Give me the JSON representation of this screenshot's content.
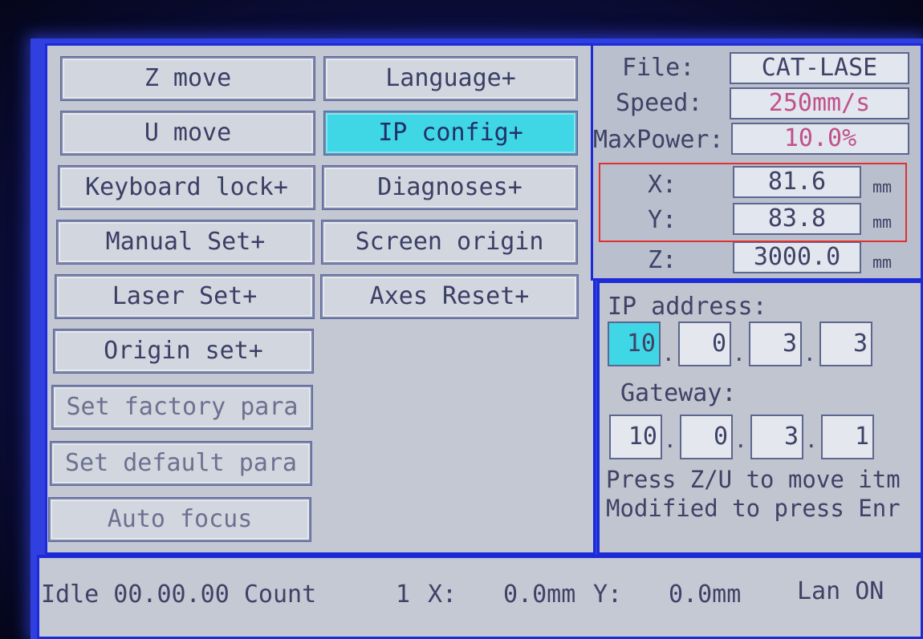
{
  "menu": {
    "left": [
      {
        "label": "Z move"
      },
      {
        "label": "U move"
      },
      {
        "label": "Keyboard lock+"
      },
      {
        "label": "Manual Set+"
      },
      {
        "label": "Laser Set+"
      },
      {
        "label": "Origin set+"
      },
      {
        "label": "Set factory para"
      },
      {
        "label": "Set default para"
      },
      {
        "label": "Auto focus"
      }
    ],
    "right": [
      {
        "label": "Language+"
      },
      {
        "label": "IP config+"
      },
      {
        "label": "Diagnoses+"
      },
      {
        "label": "Screen origin"
      },
      {
        "label": "Axes Reset+"
      }
    ]
  },
  "info": {
    "file_label": "File:",
    "file_value": "CAT-LASE",
    "speed_label": "Speed:",
    "speed_value": "250mm/s",
    "power_label": "MaxPower:",
    "power_value": "10.0%",
    "x_label": "X:",
    "x_value": "81.6",
    "y_label": "Y:",
    "y_value": "83.8",
    "z_label": "Z:",
    "z_value": "3000.0",
    "unit": "mm"
  },
  "ip": {
    "address_label": "IP address:",
    "address": [
      "10",
      "0",
      "3",
      "3"
    ],
    "gateway_label": "Gateway:",
    "gateway": [
      "10",
      "0",
      "3",
      "1"
    ],
    "hint1": "Press Z/U to move itm",
    "hint2": "Modified to press Enr"
  },
  "status": {
    "state": "Idle 00.00.00 Count",
    "count": "1",
    "x_label": "X:",
    "x_value": "0.0mm",
    "y_label": "Y:",
    "y_value": "0.0mm",
    "lan": "Lan ON"
  },
  "colors": {
    "frame": "#2f3fe0",
    "panel": "#c3c8d3",
    "active": "#3fd6e6",
    "highlight": "#e03030",
    "pink_text": "#c0508a"
  }
}
